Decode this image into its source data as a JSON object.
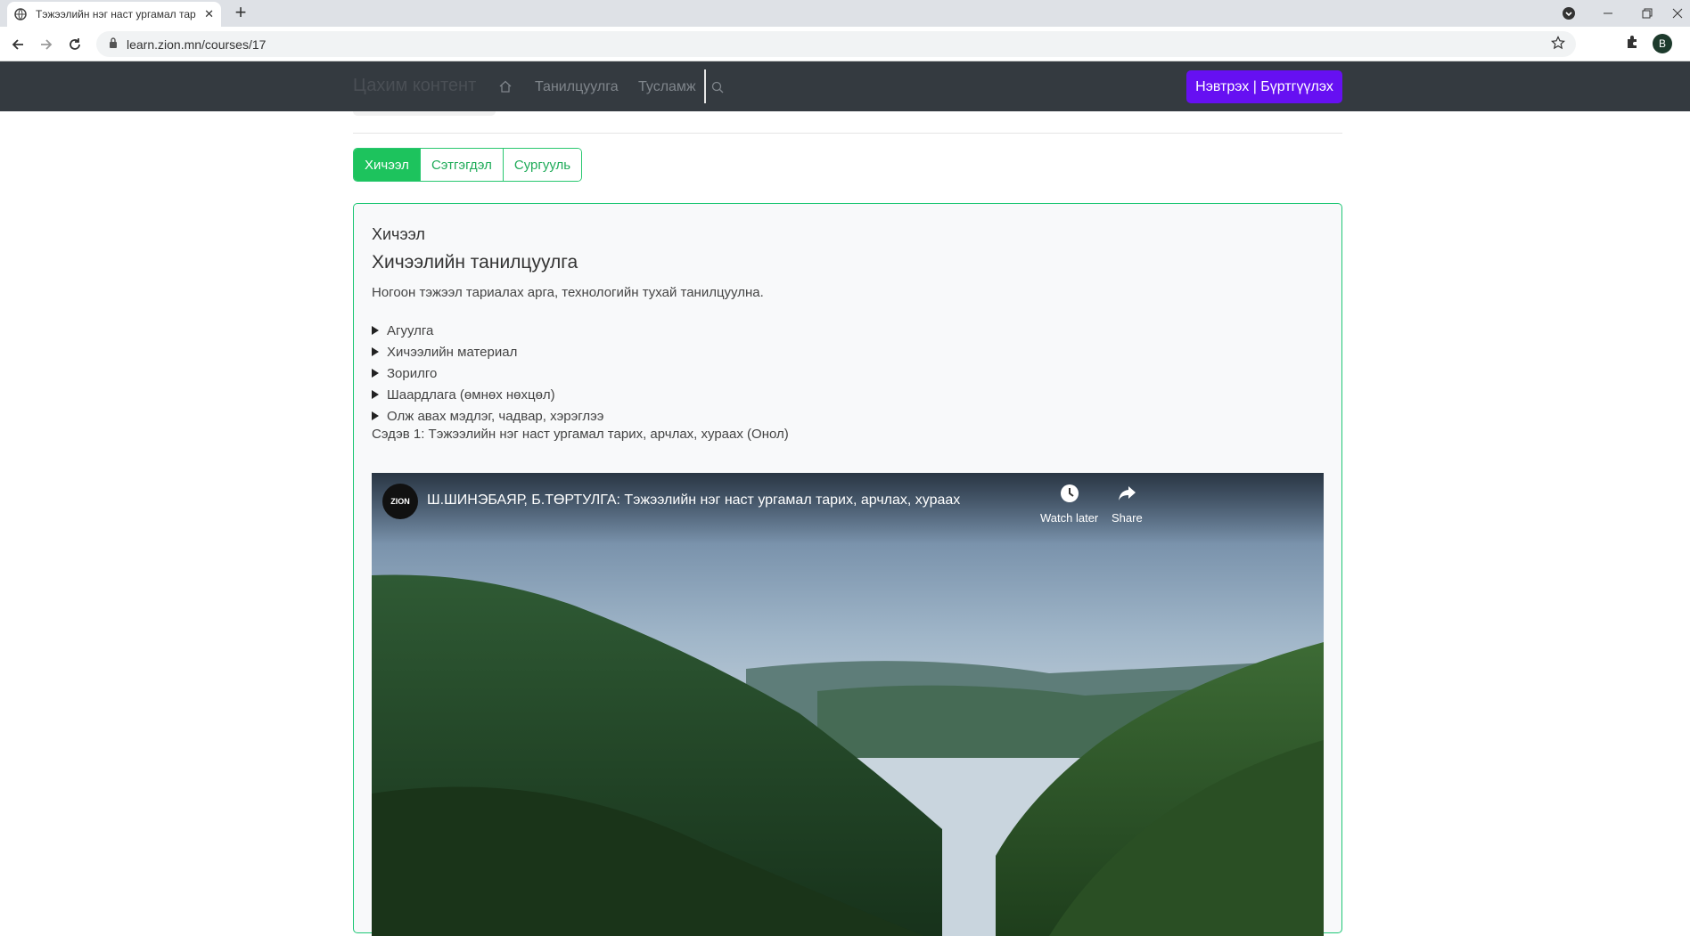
{
  "browser": {
    "tab_title": "Тэжээлийн нэг наст ургамал тар",
    "url": "learn.zion.mn/courses/17",
    "profile_initial": "B"
  },
  "nav": {
    "brand": "Цахим контент",
    "links": [
      "Танилцуулга",
      "Тусламж"
    ],
    "login_button": "Нэвтрэх | Бүртгүүлэх"
  },
  "course_tabs": {
    "items": [
      "Хичээл",
      "Сэтгэгдэл",
      "Сургууль"
    ],
    "active": "Хичээл"
  },
  "lesson": {
    "label": "Хичээл",
    "title": "Хичээлийн танилцуулга",
    "description": "Ногоон тэжээл тариалах арга, технологийн тухай танилцуулна.",
    "sections": [
      "Агуулга",
      "Хичээлийн материал",
      "Зорилго",
      "Шаардлага (өмнөх нөхцөл)",
      "Олж авах мэдлэг, чадвар, хэрэглээ"
    ],
    "topic": "Сэдэв 1: Тэжээлийн нэг наст ургамал тарих, арчлах, хураах (Онол)"
  },
  "video": {
    "channel_logo_text": "ZION",
    "title": "Ш.ШИНЭБАЯР, Б.ТӨРТУЛГА: Тэжээлийн нэг наст ургамал тарих, арчлах, хураах",
    "watch_later": "Watch later",
    "share": "Share"
  },
  "colors": {
    "navbar_bg": "#343a40",
    "login_button_bg": "#6610f2",
    "accent_green": "#1dc35d"
  }
}
